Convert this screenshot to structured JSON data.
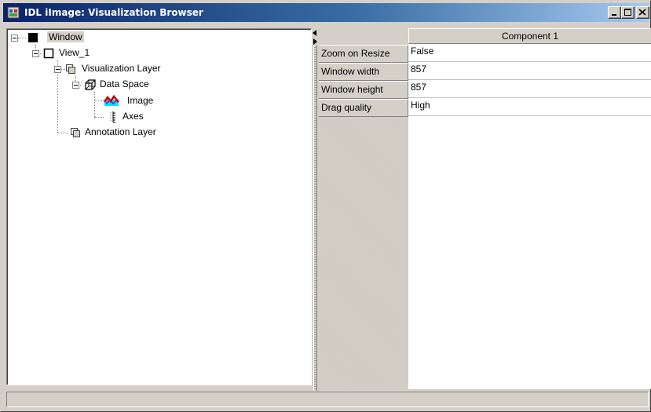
{
  "window": {
    "title": "IDL iImage: Visualization Browser"
  },
  "tree": {
    "nodes": [
      {
        "label": "Window",
        "icon": "window-square-icon",
        "selected": true
      },
      {
        "label": "View_1",
        "icon": "view-square-icon"
      },
      {
        "label": "Visualization Layer",
        "icon": "layer-icon"
      },
      {
        "label": "Data Space",
        "icon": "data-space-cube-icon"
      },
      {
        "label": "Image",
        "icon": "image-icon"
      },
      {
        "label": "Axes",
        "icon": "axes-icon"
      },
      {
        "label": "Annotation Layer",
        "icon": "layer-icon"
      }
    ]
  },
  "properties": {
    "column_header": "Component 1",
    "rows": [
      {
        "name": "Zoom on Resize",
        "value": "False"
      },
      {
        "name": "Window width",
        "value": "857"
      },
      {
        "name": "Window height",
        "value": "857"
      },
      {
        "name": "Drag quality",
        "value": "High"
      }
    ]
  },
  "colors": {
    "title_start": "#0a246a",
    "title_end": "#a6caf0",
    "face": "#d4d0c8"
  }
}
